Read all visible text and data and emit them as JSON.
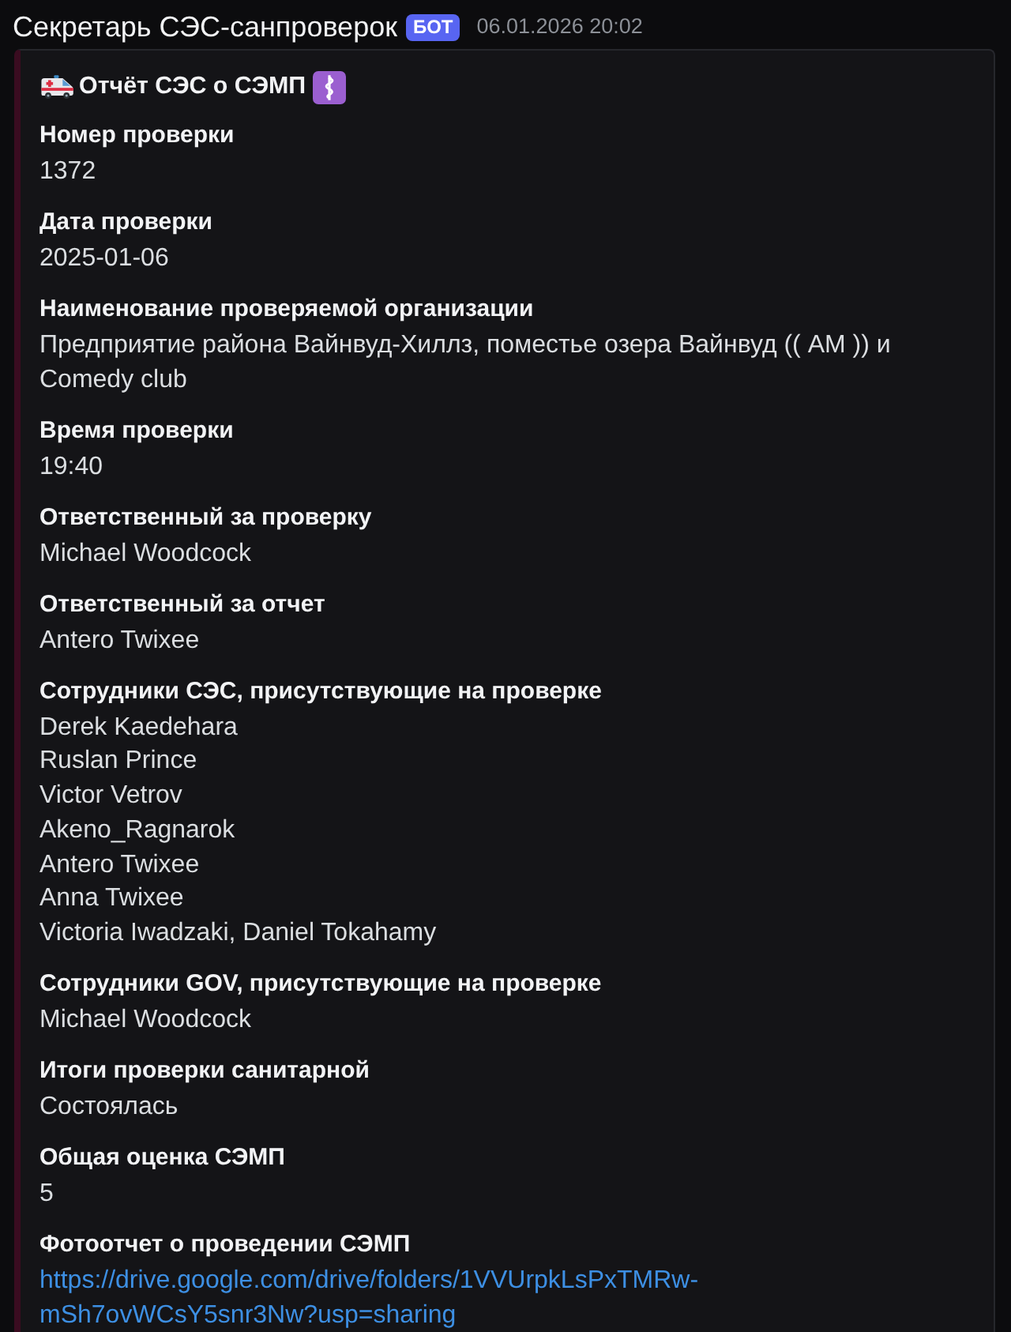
{
  "message": {
    "author": "Секретарь СЭС-санпроверок",
    "badge": "БОТ",
    "timestamp": "06.01.2026 20:02"
  },
  "embed": {
    "title": "Отчёт СЭС о СЭМП",
    "fields": [
      {
        "kind": "text",
        "name": "Номер проверки",
        "value": "1372"
      },
      {
        "kind": "text",
        "name": "Дата проверки",
        "value": "2025-01-06"
      },
      {
        "kind": "text",
        "name": "Наименование проверяемой организации",
        "value": "Предприятие района Вайнвуд-Хиллз, поместье озера Вайнвуд (( AM )) и Comedy club"
      },
      {
        "kind": "text",
        "name": "Время проверки",
        "value": "19:40"
      },
      {
        "kind": "text",
        "name": "Ответственный за проверку",
        "value": "Michael Woodcock"
      },
      {
        "kind": "text",
        "name": "Ответственный за отчет",
        "value": "Antero Twixee"
      },
      {
        "kind": "list",
        "name": "Сотрудники СЭС, присутствующие на проверке",
        "values": [
          "Derek Kaedehara",
          "Ruslan Prince",
          "Victor Vetrov",
          "Akeno_Ragnarok",
          "Antero Twixee",
          "Anna Twixee",
          "Victoria Iwadzaki, Daniel Tokahamy"
        ]
      },
      {
        "kind": "text",
        "name": "Сотрудники GOV, присутствующие на проверке",
        "value": "Michael Woodcock"
      },
      {
        "kind": "text",
        "name": "Итоги проверки санитарной",
        "value": "Состоялась"
      },
      {
        "kind": "text",
        "name": "Общая оценка СЭМП",
        "value": "5"
      },
      {
        "kind": "link",
        "name": "Фотоотчет о проведении СЭМП",
        "value": "https://drive.google.com/drive/folders/1VVUrpkLsPxTMRw-mSh7ovWCsY5snr3Nw?usp=sharing"
      }
    ]
  }
}
